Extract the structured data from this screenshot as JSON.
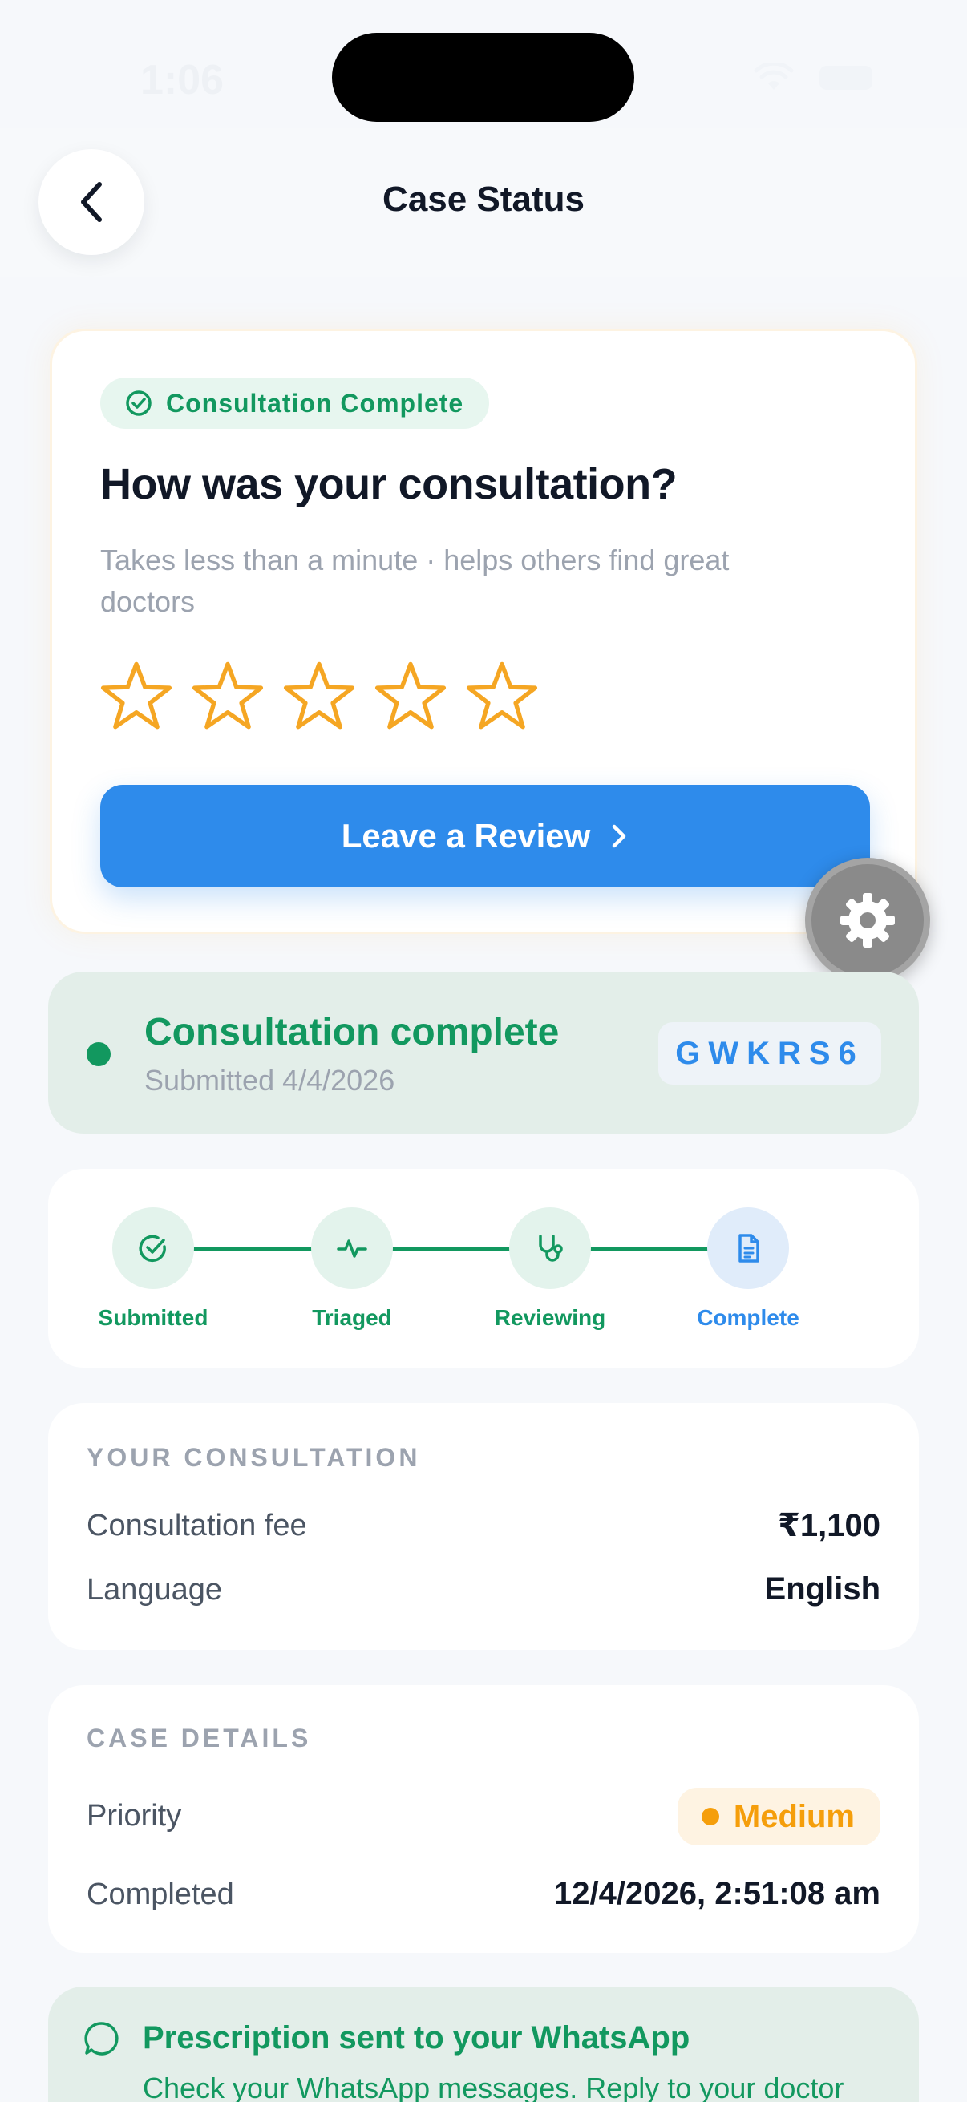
{
  "status_bar": {
    "time": "1:06"
  },
  "header": {
    "title": "Case Status"
  },
  "review": {
    "badge": "Consultation Complete",
    "title": "How was your consultation?",
    "subtitle": "Takes less than a minute · helps others find great doctors",
    "rating": 0,
    "max_rating": 5,
    "button_label": "Leave a Review"
  },
  "summary": {
    "title": "Consultation complete",
    "submitted": "Submitted 4/4/2026",
    "code": "GWKRS6"
  },
  "progress": {
    "steps": [
      {
        "label": "Submitted",
        "icon": "check-circle-icon",
        "state": "done"
      },
      {
        "label": "Triaged",
        "icon": "pulse-icon",
        "state": "done"
      },
      {
        "label": "Reviewing",
        "icon": "stethoscope-icon",
        "state": "done"
      },
      {
        "label": "Complete",
        "icon": "document-icon",
        "state": "current"
      }
    ]
  },
  "consultation": {
    "heading": "YOUR CONSULTATION",
    "fee_label": "Consultation fee",
    "fee_value": "₹1,100",
    "language_label": "Language",
    "language_value": "English"
  },
  "case_details": {
    "heading": "CASE DETAILS",
    "priority_label": "Priority",
    "priority_value": "Medium",
    "completed_label": "Completed",
    "completed_value": "12/4/2026, 2:51:08 am"
  },
  "whatsapp": {
    "title": "Prescription sent to your WhatsApp",
    "subtitle": "Check your WhatsApp messages. Reply to your doctor"
  },
  "colors": {
    "accent_blue": "#2e8beb",
    "success_green": "#12985f",
    "star_amber": "#f5a623",
    "medium_amber": "#f59e0b"
  }
}
